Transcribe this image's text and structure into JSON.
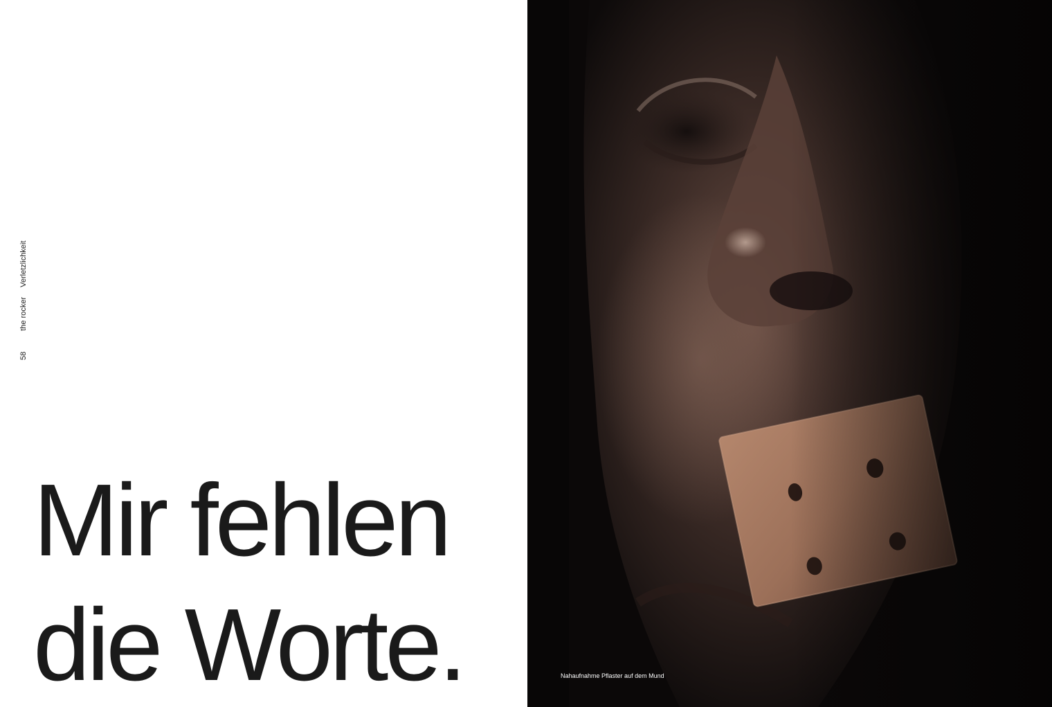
{
  "left_page": {
    "folio": "58",
    "magazine": "the rocker",
    "section": "Verletzlichkeit",
    "headline_line1": "Mir fehlen",
    "headline_line2": "die Worte."
  },
  "right_page": {
    "caption": "Nahaufnahme Pflaster auf dem Mund",
    "photo_subject": "close-up of a face with a plaster over the mouth"
  }
}
